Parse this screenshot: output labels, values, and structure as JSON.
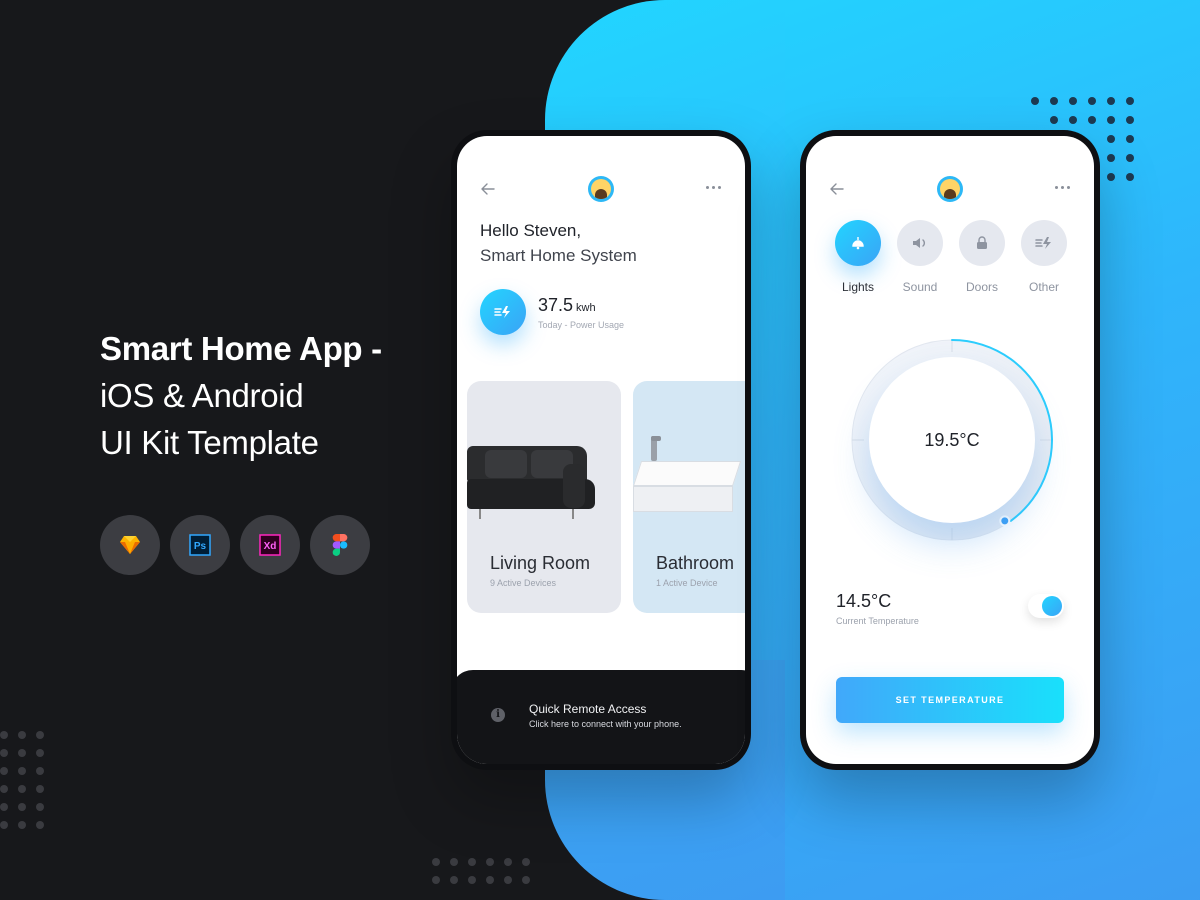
{
  "hero": {
    "line1": "Smart Home App -",
    "line2": "iOS & Android",
    "line3": "UI Kit Template"
  },
  "tools": [
    {
      "icon": "sketch-icon",
      "label": ""
    },
    {
      "icon": "photoshop-icon",
      "label": "Ps"
    },
    {
      "icon": "xd-icon",
      "label": "Xd"
    },
    {
      "icon": "figma-icon",
      "label": ""
    }
  ],
  "screen1": {
    "greeting": "Hello Steven,",
    "subtitle": "Smart Home System",
    "power": {
      "value": "37.5",
      "unit": "kwh",
      "label": "Today - Power Usage"
    },
    "rooms": [
      {
        "name": "Living Room",
        "devices": "9 Active Devices"
      },
      {
        "name": "Bathroom",
        "devices": "1 Active Device"
      }
    ],
    "remote": {
      "title": "Quick Remote Access",
      "subtitle": "Click here to connect with your phone."
    }
  },
  "screen2": {
    "devices": [
      {
        "label": "Lights",
        "icon": "lamp-icon",
        "active": true
      },
      {
        "label": "Sound",
        "icon": "speaker-icon",
        "active": false
      },
      {
        "label": "Doors",
        "icon": "lock-icon",
        "active": false
      },
      {
        "label": "Other",
        "icon": "power-icon",
        "active": false
      }
    ],
    "target_temperature": "19.5°C",
    "dial_fraction": 0.4,
    "current_temperature": "14.5°C",
    "current_label": "Current Temperature",
    "toggle_on": true,
    "button_label": "SET TEMPERATURE"
  },
  "colors": {
    "background": "#17181b",
    "accent_start": "#21d6ff",
    "accent_end": "#3d9cf2",
    "remote_bar": "#131417"
  }
}
